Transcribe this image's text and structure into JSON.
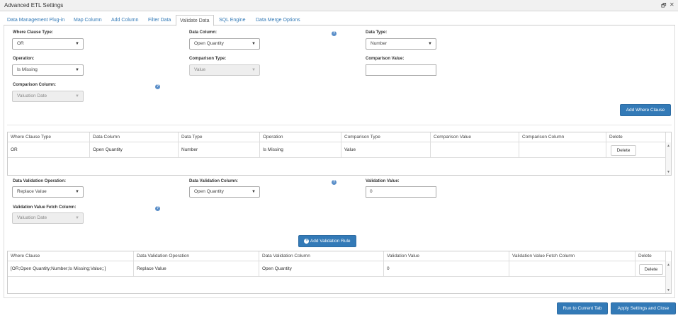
{
  "window": {
    "title": "Advanced ETL Settings",
    "restore_glyph": "🗗",
    "close_glyph": "✕"
  },
  "tabs": [
    {
      "label": "Data Management Plug-in"
    },
    {
      "label": "Map Column"
    },
    {
      "label": "Add Column"
    },
    {
      "label": "Filter Data"
    },
    {
      "label": "Validate Data"
    },
    {
      "label": "SQL Engine"
    },
    {
      "label": "Data Merge Options"
    }
  ],
  "where_form": {
    "clause_type_label": "Where Clause Type:",
    "clause_type_value": "OR",
    "data_column_label": "Data Column:",
    "data_column_value": "Open Quantity",
    "data_type_label": "Data Type:",
    "data_type_value": "Number",
    "operation_label": "Operation:",
    "operation_value": "Is Missing",
    "comparison_type_label": "Comparison Type:",
    "comparison_type_value": "Value",
    "comparison_value_label": "Comparison Value:",
    "comparison_value_value": "",
    "comparison_column_label": "Comparison Column:",
    "comparison_column_value": "Valuation Date",
    "add_button": "Add Where Clause"
  },
  "where_grid": {
    "headers": [
      "Where Clause Type",
      "Data Column",
      "Data Type",
      "Operation",
      "Comparison Type",
      "Comparison Value",
      "Comparison Column",
      "Delete"
    ],
    "rows": [
      {
        "cells": [
          "OR",
          "Open Quantity",
          "Number",
          "Is Missing",
          "Value",
          "",
          ""
        ],
        "delete_label": "Delete"
      }
    ]
  },
  "validation_form": {
    "operation_label": "Data Validation Operation:",
    "operation_value": "Replace Value",
    "column_label": "Data Validation Column:",
    "column_value": "Open Quantity",
    "value_label": "Validation Value:",
    "value_value": "0",
    "fetch_column_label": "Validation Value Fetch Column:",
    "fetch_column_value": "Valuation Date",
    "add_button": "Add Validation Rule"
  },
  "validation_grid": {
    "headers": [
      "Where Clause",
      "Data Validation Operation",
      "Data Validation Column",
      "Validation Value",
      "Validation Value Fetch Column",
      "Delete"
    ],
    "rows": [
      {
        "cells": [
          "[OR;Open Quantity;Number;Is Missing;Value;;]",
          "Replace Value",
          "Open Quantity",
          "0",
          ""
        ],
        "delete_label": "Delete"
      }
    ]
  },
  "footer": {
    "run_button": "Run to Current Tab",
    "apply_button": "Apply Settings and Close"
  },
  "icons": {
    "caret": "▼",
    "help": "?",
    "plus": "+",
    "scroll_up": "▲",
    "scroll_down": "▼"
  },
  "colors": {
    "primary": "#337ab7",
    "link": "#337ab7",
    "help": "#5b8fc9"
  }
}
